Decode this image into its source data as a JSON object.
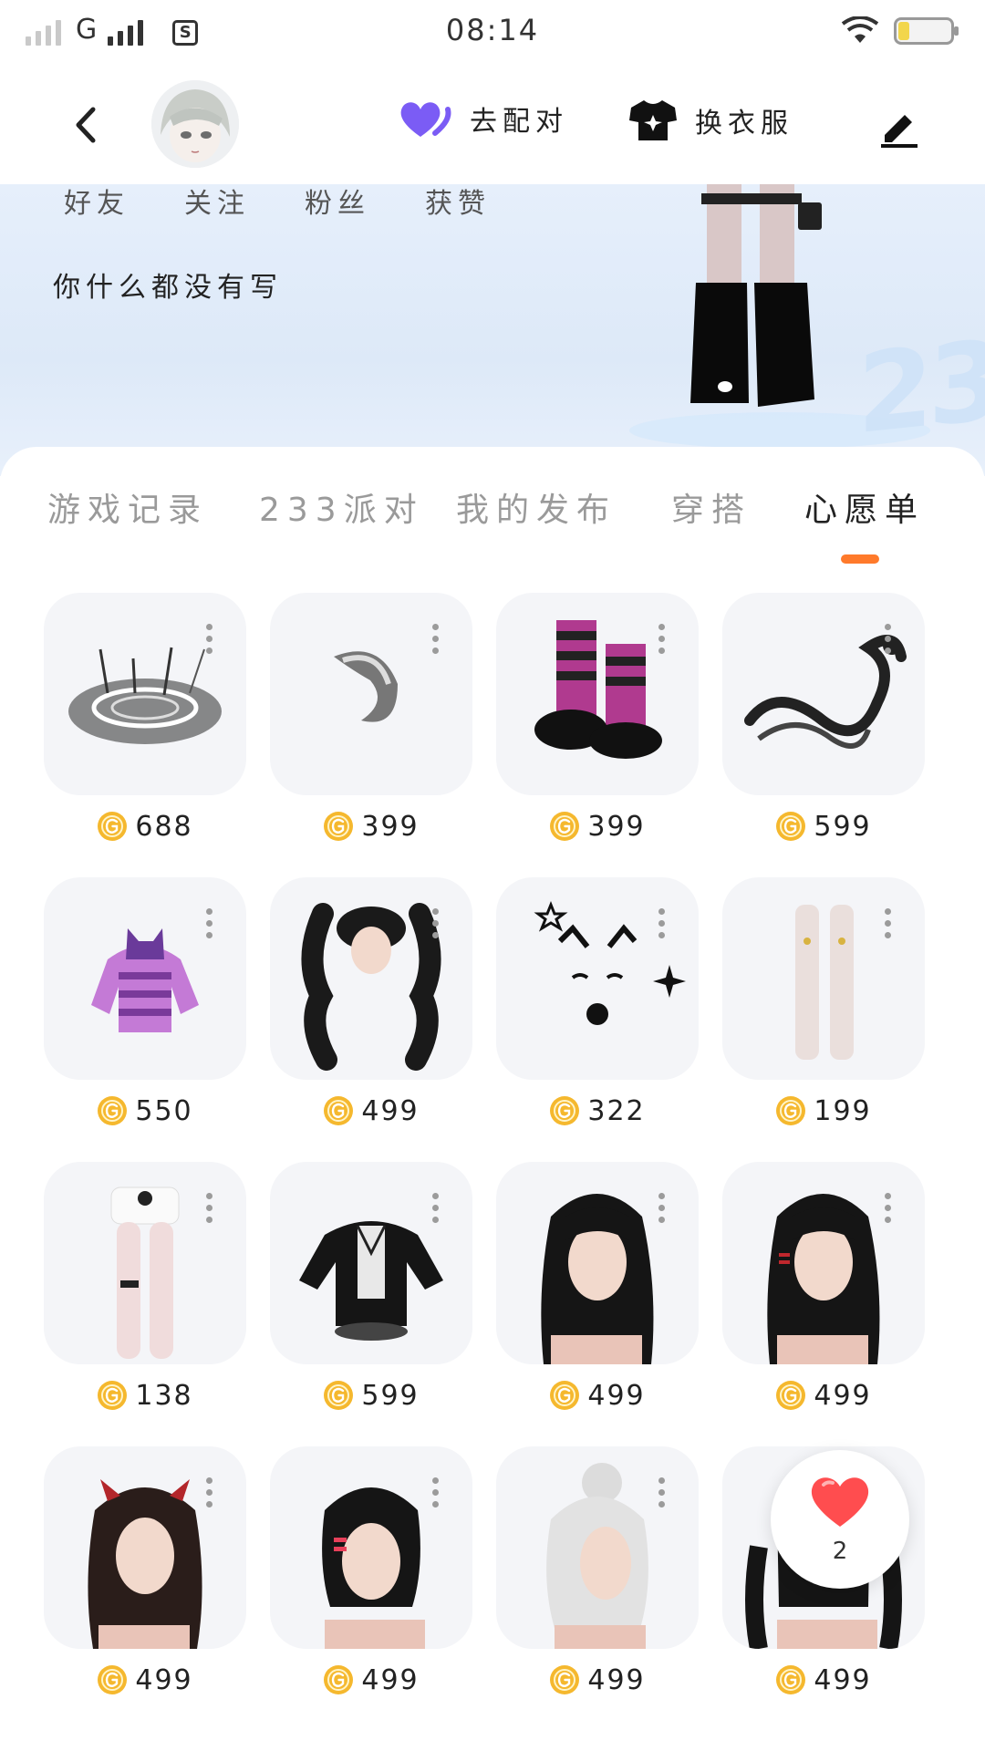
{
  "status": {
    "carrier": "G",
    "time": "08:14"
  },
  "header": {
    "match_label": "去配对",
    "dress_label": "换衣服"
  },
  "profile": {
    "stats": [
      "好友",
      "关注",
      "粉丝",
      "获赞"
    ],
    "bio": "你什么都没有写"
  },
  "tabs": [
    {
      "label": "游戏记录"
    },
    {
      "label": "233派对"
    },
    {
      "label": "我的发布"
    },
    {
      "label": "穿搭"
    },
    {
      "label": "心愿单"
    }
  ],
  "active_tab": "心愿单",
  "wishlist": [
    {
      "price": "688",
      "item": "magic-circle-icon"
    },
    {
      "price": "399",
      "item": "fluffy-tail-icon"
    },
    {
      "price": "399",
      "item": "striped-boots-icon"
    },
    {
      "price": "599",
      "item": "black-dragon-icon"
    },
    {
      "price": "550",
      "item": "purple-hoodie-icon"
    },
    {
      "price": "499",
      "item": "curly-pigtails-hair-icon"
    },
    {
      "price": "322",
      "item": "cat-face-stickers-icon"
    },
    {
      "price": "199",
      "item": "white-stockings-icon"
    },
    {
      "price": "138",
      "item": "white-shorts-icon"
    },
    {
      "price": "599",
      "item": "maid-jacket-icon"
    },
    {
      "price": "499",
      "item": "long-black-hair-icon"
    },
    {
      "price": "499",
      "item": "long-black-hair-clip-icon"
    },
    {
      "price": "499",
      "item": "devil-horn-hair-icon"
    },
    {
      "price": "499",
      "item": "short-black-hair-icon"
    },
    {
      "price": "499",
      "item": "white-bun-hair-icon"
    },
    {
      "price": "499",
      "item": "black-twintail-hair-icon"
    }
  ],
  "favorite_fab": {
    "count": "2"
  },
  "colors": {
    "accent": "#ff7a2b",
    "coin": "#f5b82e",
    "match_heart": "#7b5cf5"
  }
}
